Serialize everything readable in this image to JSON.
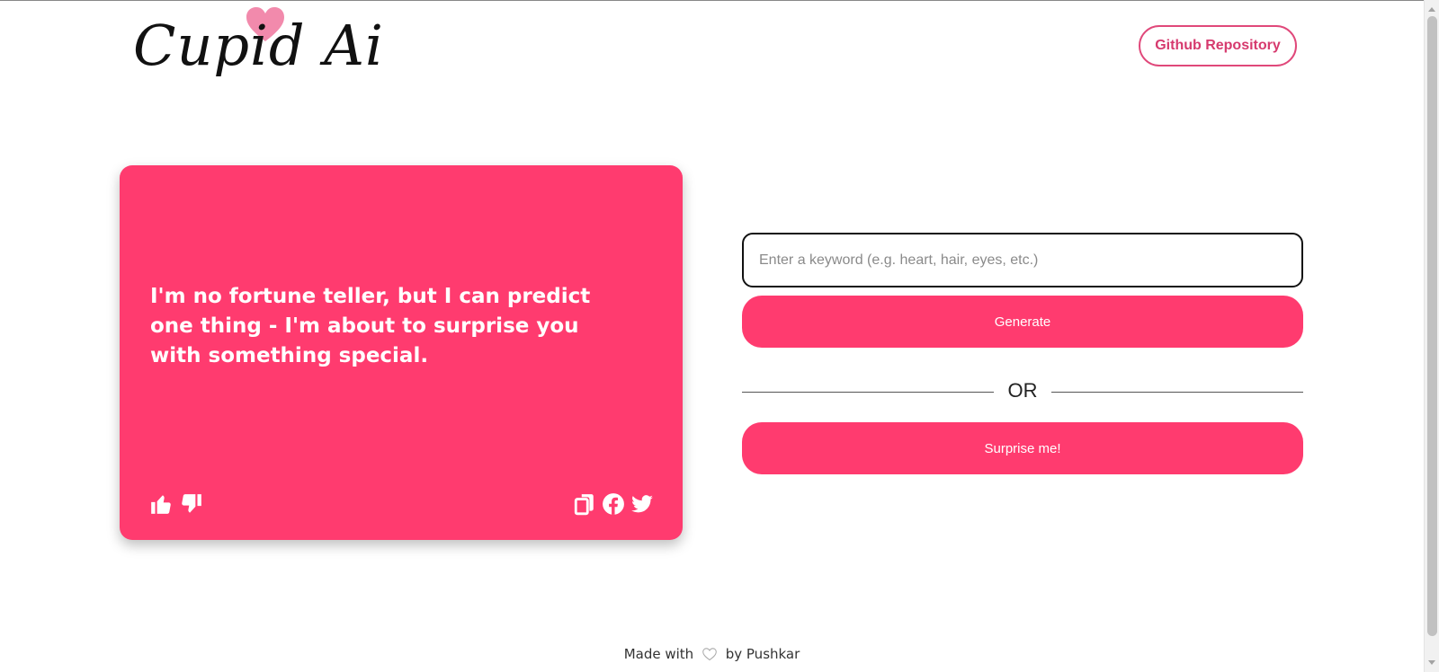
{
  "header": {
    "logo_text": "Cupid Ai",
    "github_button_label": "Github Repository"
  },
  "card": {
    "message": "I'm no fortune teller, but I can predict one thing - I'm about to surprise you with something special.",
    "icons": [
      "thumbs-up-icon",
      "thumbs-down-icon",
      "copy-icon",
      "facebook-icon",
      "twitter-icon"
    ]
  },
  "form": {
    "keyword_placeholder": "Enter a keyword (e.g. heart, hair, eyes, etc.)",
    "keyword_value": "",
    "generate_label": "Generate",
    "or_text": "OR",
    "surprise_label": "Surprise me!"
  },
  "footer": {
    "made_with": "Made with",
    "by_text": "by Pushkar"
  },
  "colors": {
    "brand_pink": "#ff3b6f",
    "logo_heart": "#f28aac",
    "github_border": "#e0487a"
  }
}
